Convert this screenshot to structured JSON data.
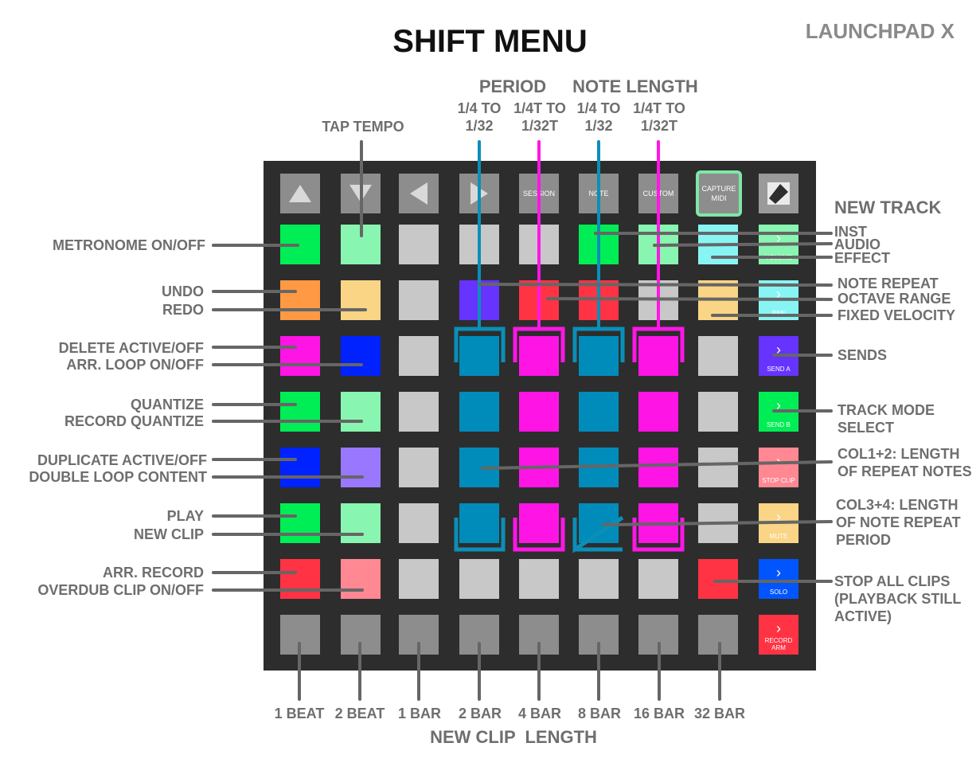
{
  "title": "SHIFT MENU",
  "model": "LAUNCHPAD X",
  "top_headers": {
    "period": "PERIOD",
    "note_length": "NOTE LENGTH",
    "period_col1": "1/4 TO\n1/32",
    "period_col2": "1/4T TO\n1/32T",
    "note_col1": "1/4 TO\n1/32",
    "note_col2": "1/4T TO\n1/32T",
    "tap_tempo": "TAP TEMPO"
  },
  "top_buttons": {
    "session": "SESSION",
    "note": "NOTE",
    "custom": "CUSTOM",
    "capture_midi": "CAPTURE\nMIDI"
  },
  "side_buttons": [
    "VOLUME",
    "PAN",
    "SEND A",
    "SEND B",
    "STOP CLIP",
    "MUTE",
    "SOLO",
    "RECORD\nARM"
  ],
  "left_labels": [
    "METRONOME ON/OFF",
    "UNDO",
    "REDO",
    "DELETE ACTIVE/OFF",
    "ARR. LOOP ON/OFF",
    "QUANTIZE",
    "RECORD QUANTIZE",
    "DUPLICATE ACTIVE/OFF",
    "DOUBLE LOOP CONTENT",
    "PLAY",
    "NEW CLIP",
    "ARR. RECORD",
    "OVERDUB CLIP ON/OFF"
  ],
  "right_labels": {
    "new_track": "NEW TRACK",
    "inst": "INST",
    "audio": "AUDIO",
    "effect": "EFFECT",
    "note_repeat": "NOTE REPEAT",
    "octave_range": "OCTAVE RANGE",
    "fixed_velocity": "FIXED VELOCITY",
    "sends": "SENDS",
    "track_mode": "TRACK MODE\nSELECT",
    "col12": "COL1+2: LENGTH\nOF REPEAT NOTES",
    "col34": "COL3+4: LENGTH\nOF NOTE REPEAT\nPERIOD",
    "stop_all": "STOP ALL CLIPS\n(PLAYBACK STILL\nACTIVE)"
  },
  "bottom_labels": [
    "1 BEAT",
    "2 BEAT",
    "1 BAR",
    "2 BAR",
    "4 BAR",
    "8 BAR",
    "16 BAR",
    "32 BAR"
  ],
  "bottom_title": "NEW CLIP  LENGTH",
  "colors": {
    "board": "#2d2d2d",
    "grey_pad": "#c8c8c8",
    "dark_pad": "#8d8d8d",
    "blue_bracket": "#0b8fb8",
    "magenta_bracket": "#ff16e6",
    "capture_outline": "#7fe6a6"
  },
  "grid_colors": [
    [
      "#00ee55",
      "#88f5b0",
      "#c8c8c8",
      "#c8c8c8",
      "#c8c8c8",
      "#00ee55",
      "#88f5b0",
      "#88f5f5"
    ],
    [
      "#ff9944",
      "#fad585",
      "#c8c8c8",
      "#6633ff",
      "#ff3344",
      "#ff3344",
      "#c8c8c8",
      "#fad585"
    ],
    [
      "#ff14e6",
      "#0022ff",
      "#c8c8c8",
      "#008cba",
      "#ff14e6",
      "#008cba",
      "#ff14e6",
      "#c8c8c8"
    ],
    [
      "#00ee55",
      "#88f5b0",
      "#c8c8c8",
      "#008cba",
      "#ff14e6",
      "#008cba",
      "#ff14e6",
      "#c8c8c8"
    ],
    [
      "#0022ff",
      "#9977ff",
      "#c8c8c8",
      "#008cba",
      "#ff14e6",
      "#008cba",
      "#ff14e6",
      "#c8c8c8"
    ],
    [
      "#00ee55",
      "#88f5b0",
      "#c8c8c8",
      "#008cba",
      "#ff14e6",
      "#008cba",
      "#ff14e6",
      "#c8c8c8"
    ],
    [
      "#ff3344",
      "#ff8893",
      "#c8c8c8",
      "#c8c8c8",
      "#c8c8c8",
      "#c8c8c8",
      "#c8c8c8",
      "#ff3344"
    ],
    [
      "#8d8d8d",
      "#8d8d8d",
      "#8d8d8d",
      "#8d8d8d",
      "#8d8d8d",
      "#8d8d8d",
      "#8d8d8d",
      "#8d8d8d"
    ]
  ],
  "side_colors": [
    "#88f5b0",
    "#88f5f5",
    "#6633ff",
    "#00ee55",
    "#ff8893",
    "#fad585",
    "#0055ff",
    "#ff3344"
  ]
}
